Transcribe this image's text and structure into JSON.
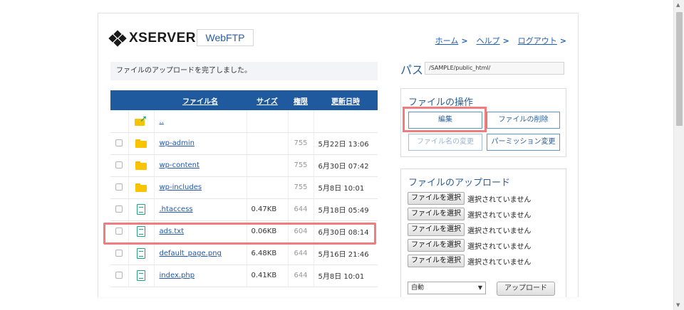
{
  "header": {
    "logo_text": "XSERVER",
    "app_name": "WebFTP",
    "nav": [
      {
        "label": "ホーム",
        "chevron": ">"
      },
      {
        "label": "ヘルプ",
        "chevron": ">"
      },
      {
        "label": "ログアウト",
        "chevron": ">"
      }
    ]
  },
  "message": "ファイルのアップロードを完了しました。",
  "table": {
    "headers": {
      "name": "ファイル名",
      "size": "サイズ",
      "perm": "権限",
      "date": "更新日時"
    },
    "parent_link": "..",
    "rows": [
      {
        "type": "folder",
        "name": "wp-admin",
        "size": "",
        "perm": "755",
        "date": "5月22日 13:06"
      },
      {
        "type": "folder",
        "name": "wp-content",
        "size": "",
        "perm": "755",
        "date": "6月30日 07:42"
      },
      {
        "type": "folder",
        "name": "wp-includes",
        "size": "",
        "perm": "755",
        "date": "5月8日 10:01"
      },
      {
        "type": "file",
        "name": ".htaccess",
        "size": "0.47KB",
        "perm": "644",
        "date": "5月18日 05:49"
      },
      {
        "type": "file",
        "name": "ads.txt",
        "size": "0.06KB",
        "perm": "604",
        "date": "6月30日 08:14"
      },
      {
        "type": "file",
        "name": "default_page.png",
        "size": "6.48KB",
        "perm": "644",
        "date": "5月16日 21:46"
      },
      {
        "type": "file",
        "name": "index.php",
        "size": "0.41KB",
        "perm": "644",
        "date": "5月8日 10:01"
      }
    ]
  },
  "path": {
    "label": "パス",
    "value": "/SAMPLE/public_html/"
  },
  "operations": {
    "title": "ファイルの操作",
    "edit": "編集",
    "delete": "ファイルの削除",
    "rename": "ファイル名の変更",
    "permission": "パーミッション変更"
  },
  "upload": {
    "title": "ファイルのアップロード",
    "choose_label": "ファイルを選択",
    "status": "選択されていません",
    "mode_value": "自動",
    "upload_button": "アップロード"
  },
  "colors": {
    "header_blue": "#1f5a9f",
    "highlight": "#ee7d80",
    "link": "#2057a8"
  }
}
